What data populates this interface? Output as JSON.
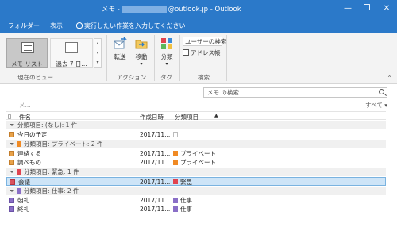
{
  "window": {
    "title_prefix": "メモ - ",
    "title_suffix": "@outlook.jp - Outlook",
    "minimize": "—",
    "restore": "❐",
    "close": "✕"
  },
  "tabs": {
    "folder": "フォルダー",
    "view": "表示",
    "tellme": "実行したい作業を入力してください"
  },
  "ribbon": {
    "view_memo_list": "メモ リスト",
    "view_last7": "過去 7 日...",
    "group_current_view": "現在のビュー",
    "move_forward": "転送",
    "move": "移動",
    "group_action": "アクション",
    "categorize": "分類",
    "group_tags": "タグ",
    "user_search": "ユーザーの検索",
    "address_book": "アドレス帳",
    "group_search": "検索",
    "collapse": "⌃"
  },
  "list": {
    "search_placeholder": "メモ の検索",
    "filter_placeholder": "メ...",
    "all_filter": "すべて ▾",
    "headers": {
      "subject": "件名",
      "created": "作成日時",
      "category": "分類項目"
    },
    "groups": [
      {
        "label": "分類項目: (なし): 1 件"
      },
      {
        "label": "分類項目: プライベート: 2 件"
      },
      {
        "label": "分類項目: 緊急: 1 件"
      },
      {
        "label": "分類項目: 仕事: 2 件"
      }
    ],
    "rows": [
      {
        "subject": "今日の予定",
        "created": "2017/11...",
        "category": ""
      },
      {
        "subject": "連絡する",
        "created": "2017/11...",
        "category": "プライベート"
      },
      {
        "subject": "調べもの",
        "created": "2017/11...",
        "category": "プライベート"
      },
      {
        "subject": "会議",
        "created": "2017/11...",
        "category": "緊急"
      },
      {
        "subject": "朝礼",
        "created": "2017/11...",
        "category": "仕事"
      },
      {
        "subject": "終礼",
        "created": "2017/11...",
        "category": "仕事"
      }
    ]
  },
  "colors": {
    "titlebar": "#2b79c9",
    "private": "#f08a24",
    "urgent": "#e0434f",
    "work": "#8a6fc7",
    "selection": "#cde4f7"
  }
}
